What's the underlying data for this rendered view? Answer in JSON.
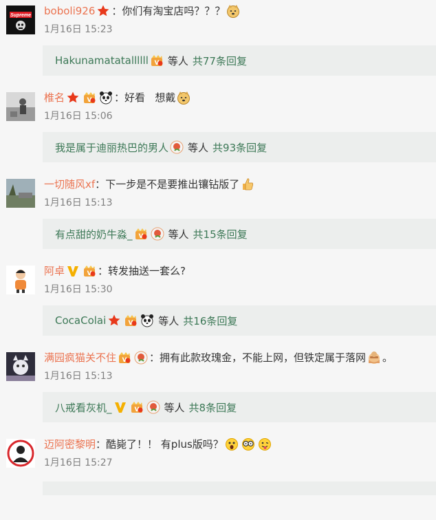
{
  "comments": [
    {
      "user": "boboli926",
      "text": "你们有淘宝店吗？？？",
      "time": "1月16日 15:23",
      "reply_user": "Hakunamatatallllll",
      "reply_mid": "等人",
      "reply_count": "共77条回复",
      "avatar_label": "Supreme"
    },
    {
      "user": "椎名",
      "text": "好看   想戴",
      "time": "1月16日 15:06",
      "reply_user": "我是属于迪丽热巴的男人",
      "reply_mid": "等人",
      "reply_count": "共93条回复"
    },
    {
      "user": "一切随风xf",
      "text": "下一步是不是要推出镶钻版了",
      "time": "1月16日 15:13",
      "reply_user": "有点甜的奶牛淼_",
      "reply_mid": "等人",
      "reply_count": "共15条回复"
    },
    {
      "user": "阿卓",
      "text": "转发抽送一套么?",
      "time": "1月16日 15:30",
      "reply_user": "CocaColai",
      "reply_mid": "等人",
      "reply_count": "共16条回复"
    },
    {
      "user": "满园疯猫关不住",
      "text": "拥有此款玫瑰金，不能上网，但铁定属于落网",
      "text_end": "。",
      "time": "1月16日 15:13",
      "reply_user": "八戒看灰机_",
      "reply_mid": "等人",
      "reply_count": "共8条回复"
    },
    {
      "user": "迈阿密黎明",
      "text": "酷毙了！！ 有plus版吗？",
      "time": "1月16日 15:27"
    }
  ],
  "colors": {
    "username": "#eb7350",
    "reply_link": "#3c7856",
    "reply_bg": "#eceeed",
    "page_bg": "#f6f6f6"
  },
  "icons": [
    "star-badge-icon",
    "vip-badge-icon",
    "rose-badge-icon",
    "panda-icon",
    "verified-v-icon",
    "doge-emoji-icon",
    "thumbs-up-emoji-icon",
    "fox-emoji-icon",
    "scared-emoji-icon",
    "glasses-emoji-icon",
    "tongue-emoji-icon"
  ]
}
